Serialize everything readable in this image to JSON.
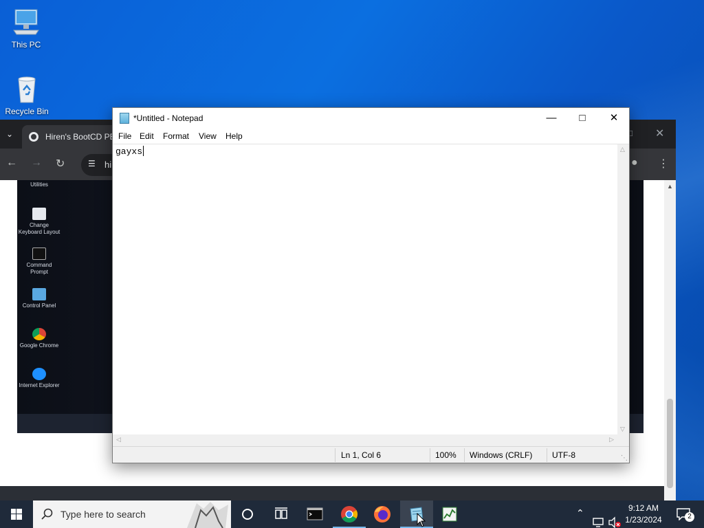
{
  "desktop": {
    "icons": [
      {
        "label": "This PC",
        "icon": "computer-icon"
      },
      {
        "label": "Recycle Bin",
        "icon": "recycle-bin-icon"
      }
    ]
  },
  "chrome": {
    "tab_title": "Hiren's BootCD PE",
    "address": "hi",
    "bootcd_items": [
      "Utilities",
      "Change Keyboard Layout",
      "Command Prompt",
      "Control Panel",
      "Google Chrome",
      "Internet Explorer"
    ]
  },
  "notepad": {
    "title": "*Untitled - Notepad",
    "menu": [
      "File",
      "Edit",
      "Format",
      "View",
      "Help"
    ],
    "content": "gayxs",
    "status": {
      "position": "Ln 1, Col 6",
      "zoom": "100%",
      "line_ending": "Windows (CRLF)",
      "encoding": "UTF-8"
    }
  },
  "taskbar": {
    "search_placeholder": "Type here to search",
    "pinned": [
      "cortana-icon",
      "task-view-icon",
      "command-prompt-icon",
      "chrome-icon",
      "firefox-icon",
      "notepad-icon",
      "task-manager-icon"
    ],
    "clock_time": "9:12 AM",
    "clock_date": "1/23/2024",
    "notification_count": "2"
  },
  "colors": {
    "taskbar_bg": "#1f2a3a",
    "accent": "#76b9ed",
    "chrome_dark": "#202124"
  }
}
